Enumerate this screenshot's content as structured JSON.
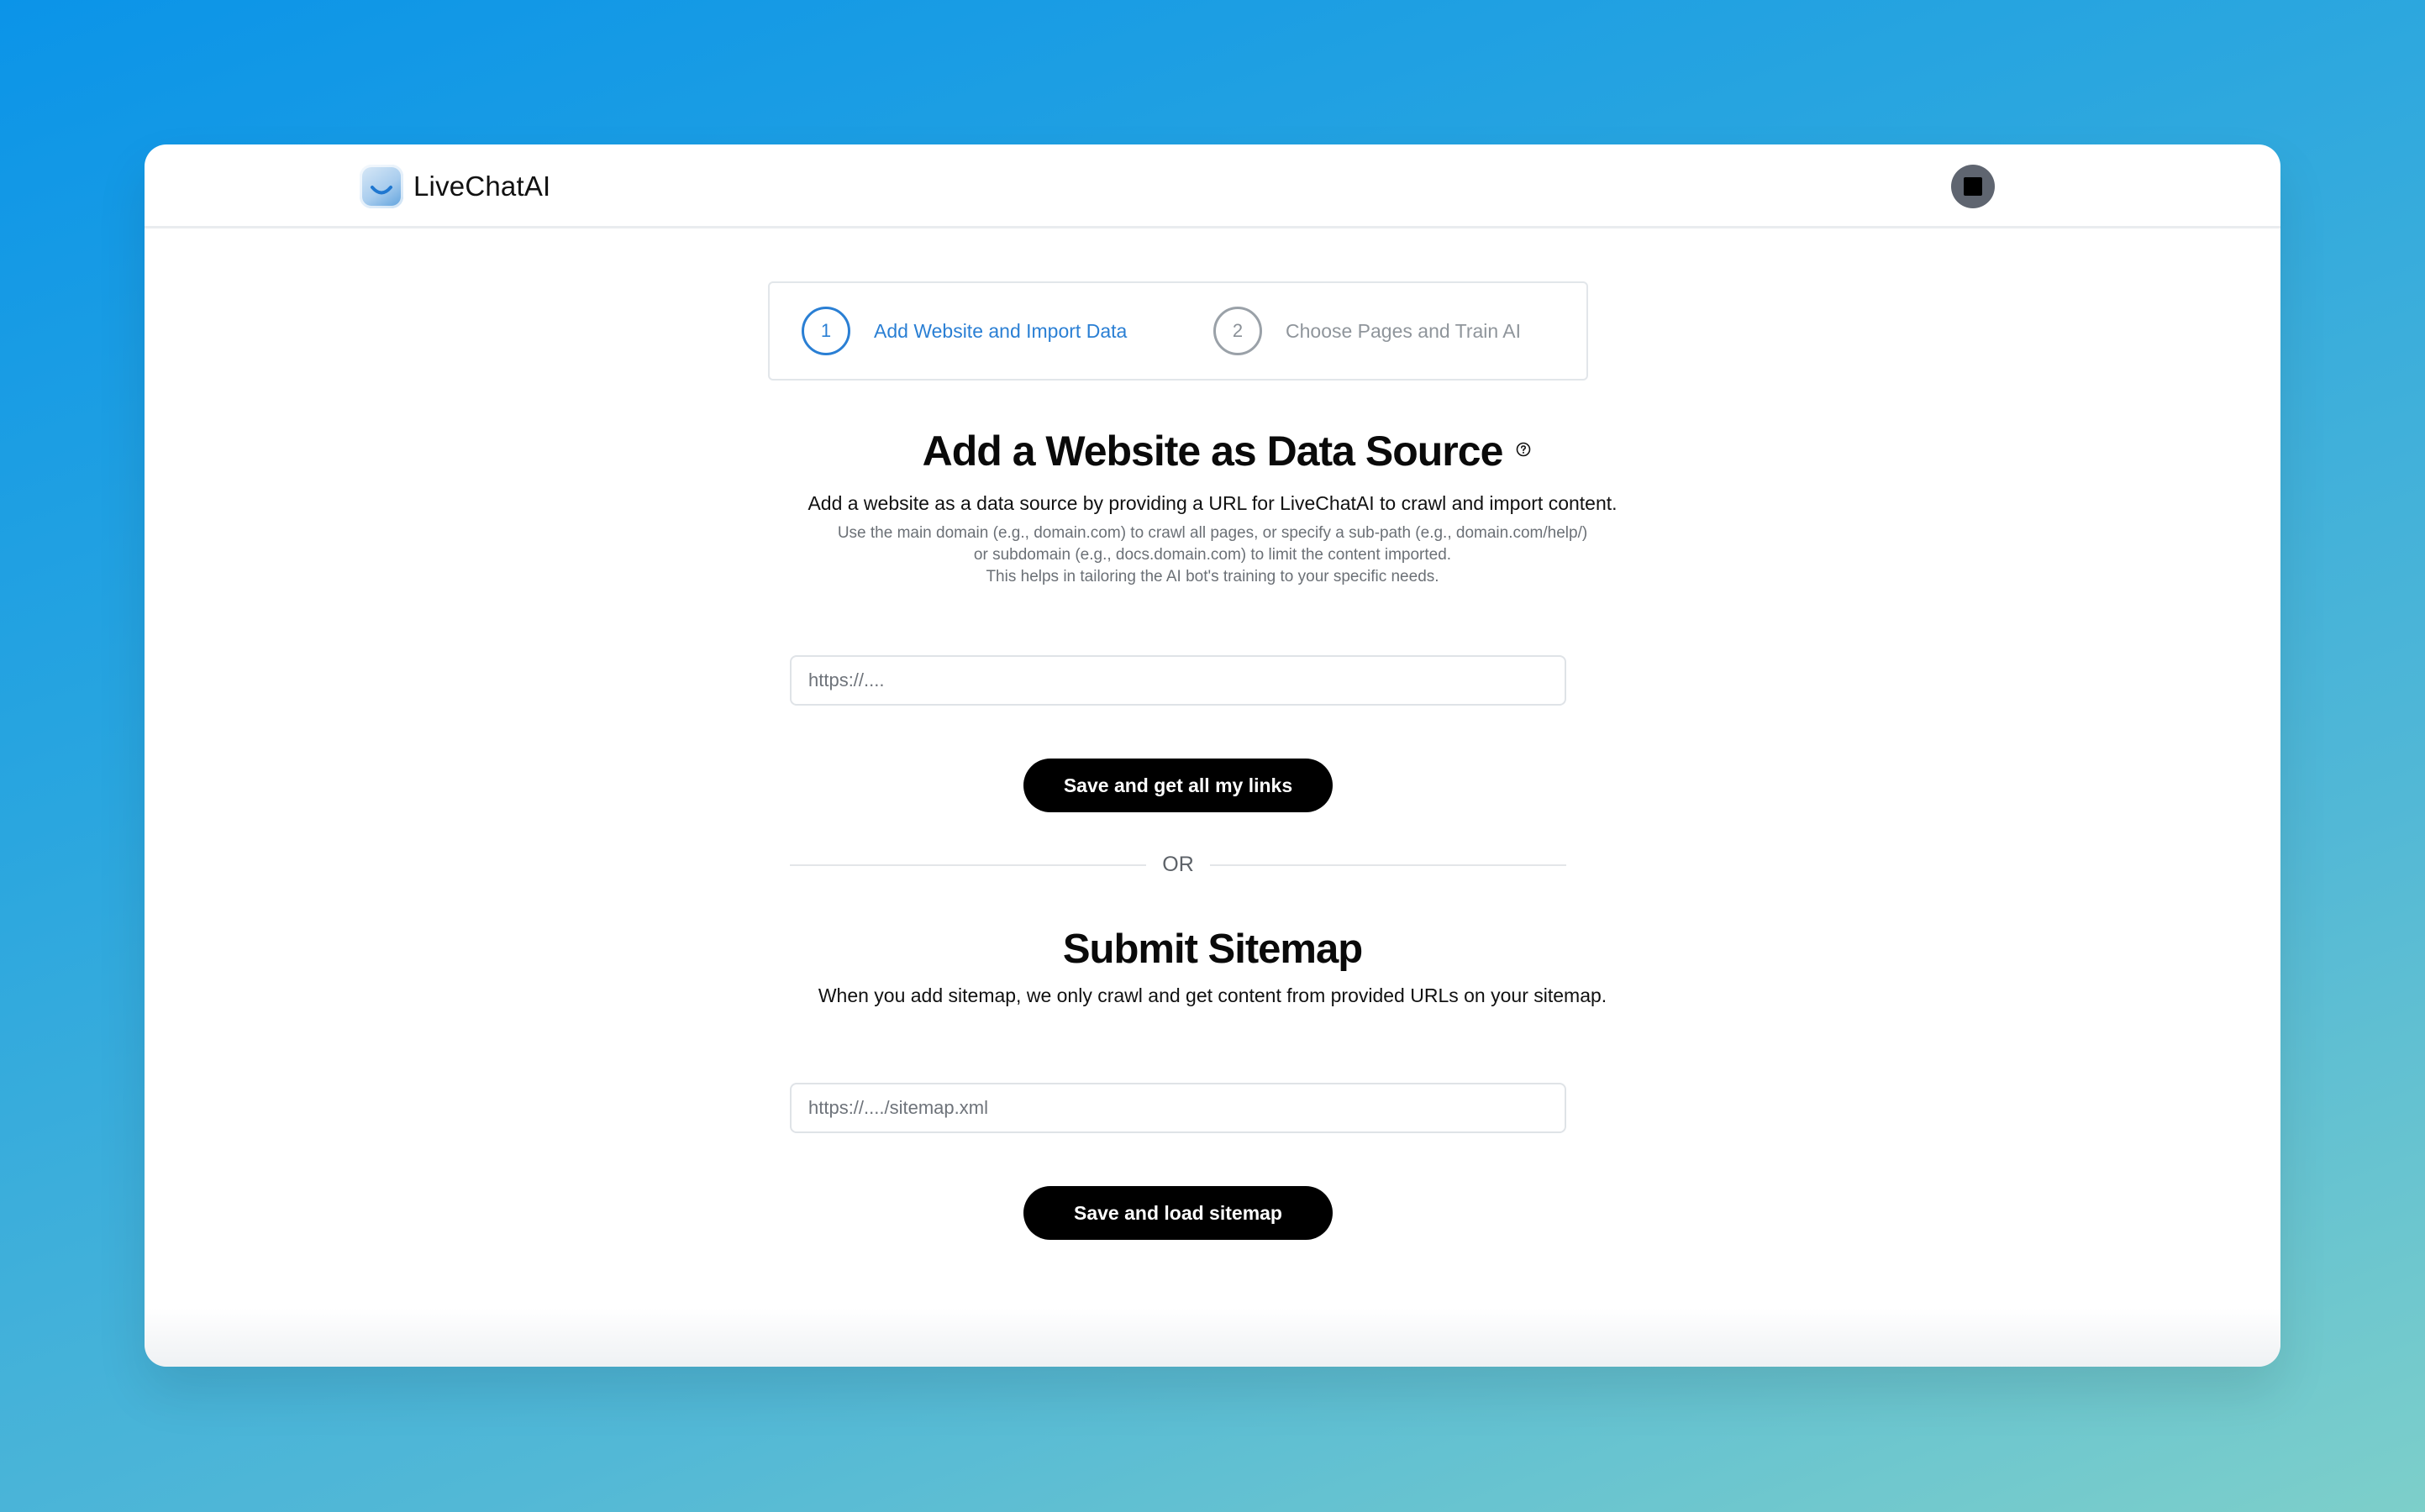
{
  "app": {
    "logo_text": "LiveChatAI"
  },
  "stepper": {
    "steps": [
      {
        "number": "1",
        "label": "Add Website and Import Data",
        "state": "active"
      },
      {
        "number": "2",
        "label": "Choose Pages and Train AI",
        "state": "inactive"
      }
    ]
  },
  "website_section": {
    "title": "Add a Website as Data Source",
    "lead": "Add a website as a data source by providing a URL for LiveChatAI to crawl and import content.",
    "help_lines": [
      "Use the main domain (e.g., domain.com) to crawl all pages, or specify a sub-path (e.g., domain.com/help/)",
      "or subdomain (e.g., docs.domain.com) to limit the content imported.",
      "This helps in tailoring the AI bot's training to your specific needs."
    ],
    "url_input": {
      "value": "",
      "placeholder": "https://...."
    },
    "button_label": "Save and get all my links"
  },
  "divider": {
    "label": "OR"
  },
  "sitemap_section": {
    "title": "Submit Sitemap",
    "lead": "When you add sitemap, we only crawl and get content from provided URLs on your sitemap.",
    "sitemap_input": {
      "value": "",
      "placeholder": "https://..../sitemap.xml"
    },
    "button_label": "Save and load sitemap"
  },
  "icons": {
    "logo": "smile-logo-icon",
    "help": "question-circle-icon",
    "avatar": "user-avatar"
  },
  "colors": {
    "accent": "#2a7fd4",
    "button": "#000000",
    "inactive_step": "#8f959b"
  }
}
